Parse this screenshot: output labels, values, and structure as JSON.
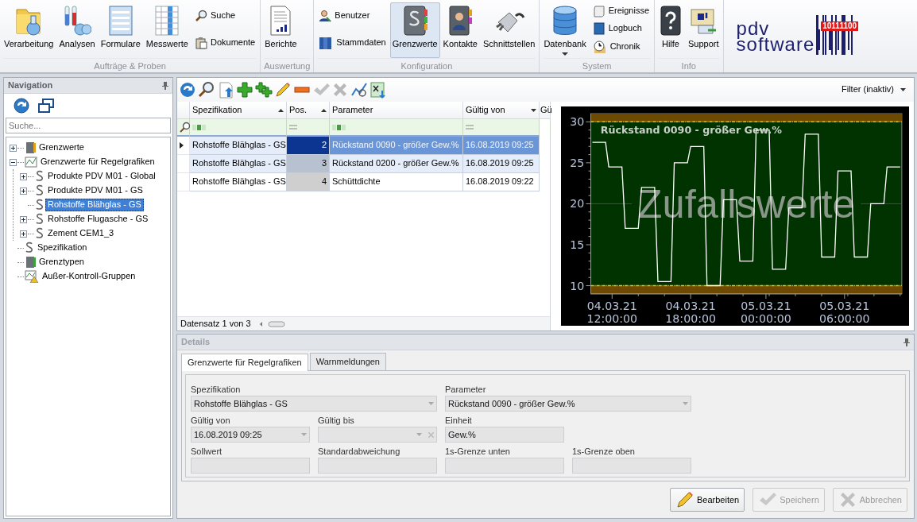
{
  "ribbon": {
    "groups": [
      {
        "label": "Aufträge & Proben",
        "items": [
          {
            "label": "Verarbeitung",
            "kind": "large",
            "selected": false
          },
          {
            "label": "Analysen",
            "kind": "large",
            "selected": false
          },
          {
            "label": "Formulare",
            "kind": "large",
            "selected": false
          },
          {
            "label": "Messwerte",
            "kind": "large",
            "selected": false
          },
          {
            "label": "Suche",
            "kind": "small",
            "selected": false
          },
          {
            "label": "Dokumente",
            "kind": "small",
            "selected": false
          }
        ]
      },
      {
        "label": "Auswertung",
        "items": [
          {
            "label": "Berichte",
            "kind": "large",
            "selected": false
          }
        ]
      },
      {
        "label": "Konfiguration",
        "items": [
          {
            "label": "Benutzer",
            "kind": "small",
            "selected": false
          },
          {
            "label": "Stammdaten",
            "kind": "small",
            "selected": false
          },
          {
            "label": "Grenzwerte",
            "kind": "large",
            "selected": true
          },
          {
            "label": "Kontakte",
            "kind": "large",
            "selected": false
          },
          {
            "label": "Schnittstellen",
            "kind": "large",
            "selected": false
          }
        ]
      },
      {
        "label": "System",
        "items": [
          {
            "label": "Datenbank",
            "kind": "large",
            "selected": false,
            "dropdown": true
          },
          {
            "label": "Ereignisse",
            "kind": "small",
            "selected": false
          },
          {
            "label": "Logbuch",
            "kind": "small",
            "selected": false
          },
          {
            "label": "Chronik",
            "kind": "small",
            "selected": false
          }
        ]
      },
      {
        "label": "Info",
        "items": [
          {
            "label": "Hilfe",
            "kind": "large",
            "selected": false
          },
          {
            "label": "Support",
            "kind": "large",
            "selected": false
          }
        ]
      }
    ],
    "logo": {
      "line_1": "pdv",
      "line_2": "software",
      "code": "10111100"
    }
  },
  "navigation": {
    "title": "Navigation",
    "search": {
      "placeholder": "Suche..."
    },
    "tree": [
      {
        "label": "Grenzwerte",
        "expanded": false,
        "selected": false
      },
      {
        "label": "Grenzwerte für Regelgrafiken",
        "expanded": true,
        "selected": false,
        "children": [
          {
            "label": "Produkte PDV M01 - Global",
            "expanded": false,
            "selected": false
          },
          {
            "label": "Produkte PDV M01 - GS",
            "expanded": false,
            "selected": false
          },
          {
            "label": "Rohstoffe Blähglas - GS",
            "selected": true
          },
          {
            "label": "Rohstoffe Flugasche - GS",
            "expanded": false,
            "selected": false
          },
          {
            "label": "Zement CEM1_3",
            "expanded": false,
            "selected": false
          }
        ]
      },
      {
        "label": "Spezifikation",
        "selected": false
      },
      {
        "label": "Grenztypen",
        "selected": false
      },
      {
        "label": "Außer-Kontroll-Gruppen",
        "selected": false
      }
    ]
  },
  "toolbar": {
    "filter": "Filter (inaktiv)"
  },
  "table": {
    "columns": [
      {
        "label": "Spezifikation",
        "sorted": true,
        "descending": false
      },
      {
        "label": "Pos.",
        "sorted": true,
        "descending": false
      },
      {
        "label": "Parameter",
        "sorted": false
      },
      {
        "label": "Gültig von",
        "sorted": true,
        "descending": true
      },
      {
        "label": "Gü",
        "sorted": false
      }
    ],
    "rows": [
      {
        "cells": [
          "Rohstoffe Blähglas - GS",
          "2",
          "Rückstand 0090 - größer Gew.%",
          "16.08.2019 09:25"
        ],
        "selected": true,
        "current": true
      },
      {
        "cells": [
          "Rohstoffe Blähglas - GS",
          "3",
          "Rückstand 0200 - größer Gew.%",
          "16.08.2019 09:25"
        ],
        "selected": true,
        "current": false
      },
      {
        "cells": [
          "Rohstoffe Blähglas - GS",
          "4",
          "Schüttdichte",
          "16.08.2019 09:22"
        ],
        "selected": false,
        "current": false
      }
    ],
    "footer": "Datensatz 1 von 3"
  },
  "chart": {
    "chart_data": {
      "type": "line",
      "title": "Rückstand 0090 - größer Gew.%",
      "categories": [
        null,
        null,
        null,
        null,
        null,
        null,
        "04.03.21 12:00:00",
        null,
        null,
        null,
        null,
        null,
        null,
        null,
        null,
        null,
        null,
        null,
        null,
        null,
        null,
        null,
        null,
        null,
        null,
        null,
        null,
        null,
        null,
        null,
        "04.03.21 18:00:00",
        null,
        null,
        null,
        null,
        null,
        null,
        null,
        null,
        null,
        null,
        null,
        null,
        null,
        null,
        null,
        null,
        null,
        null,
        null,
        null,
        null,
        null,
        "05.03.21 00:00:00",
        null,
        null,
        null,
        null,
        null,
        null,
        null,
        null,
        null,
        null,
        null,
        null,
        null,
        null,
        null,
        null,
        null,
        null,
        null,
        null,
        null,
        null,
        null,
        "05.03.21 06:00:00",
        null,
        null,
        null,
        null,
        null,
        null,
        null,
        null,
        null,
        null,
        null,
        null,
        null,
        null,
        null,
        null,
        null
      ],
      "series": [
        {
          "color": "#ffffff",
          "values": [
            27.5,
            27.5,
            27.5,
            27.5,
            27.5,
            24.5,
            24.5,
            24.5,
            24.5,
            24.5,
            17,
            17,
            17,
            17,
            17,
            22,
            22,
            22,
            22,
            22,
            10.5,
            10.5,
            10.5,
            10.5,
            10.5,
            25,
            25,
            25,
            25,
            25,
            27,
            27,
            27,
            27,
            27,
            10,
            10,
            10,
            10,
            10,
            20.5,
            20.5,
            20.5,
            20.5,
            20.5,
            13,
            13,
            13,
            13,
            13,
            29,
            29,
            29,
            29,
            29,
            12,
            12,
            12,
            12,
            12,
            19.5,
            19.5,
            19.5,
            19.5,
            19.5,
            28.5,
            28.5,
            28.5,
            28.5,
            28.5,
            13.5,
            13.5,
            13.5,
            13.5,
            13.5,
            24,
            24,
            24,
            24,
            24,
            13.5,
            13.5,
            13.5,
            13.5,
            13.5,
            20,
            20,
            20,
            20,
            20,
            24.5,
            24.5,
            24.5,
            24.5,
            24.5
          ]
        }
      ],
      "ylim": [
        9,
        31
      ],
      "yticks": [
        10,
        15,
        20,
        25,
        30
      ],
      "bands": [
        {
          "axis": "y",
          "from": 30,
          "to": 31
        },
        {
          "axis": "y",
          "from": 9,
          "to": 10
        }
      ],
      "ref_lines": [
        {
          "axis": "y",
          "value": 30
        },
        {
          "axis": "y",
          "value": 10
        }
      ],
      "annotations": [
        "Zufallswerte"
      ]
    }
  },
  "details": {
    "title": "Details",
    "tabs": [
      {
        "label": "Grenzwerte für Regelgrafiken",
        "selected": true
      },
      {
        "label": "Warnmeldungen",
        "selected": false
      }
    ],
    "rows": [
      [
        {
          "label": "Spezifikation",
          "value": "Rohstoffe Blähglas - GS",
          "kind": "combo_wide"
        },
        "",
        {
          "label": "Parameter",
          "value": "Rückstand 0090 - größer Gew.%",
          "kind": "combo_wide"
        }
      ],
      [
        {
          "label": "Gültig von",
          "value": "16.08.2019 09:25",
          "kind": "date"
        },
        {
          "label": "Gültig bis",
          "kind": "date_clear"
        },
        {
          "label": "Einheit",
          "value": "Gew.%",
          "kind": "text"
        }
      ],
      [
        {
          "label": "Sollwert",
          "kind": "text"
        },
        {
          "label": "Standardabweichung",
          "kind": "text"
        },
        {
          "label": "1s-Grenze unten",
          "kind": "text"
        },
        {
          "label": "1s-Grenze oben",
          "kind": "text"
        }
      ]
    ],
    "buttons": [
      {
        "label": "Bearbeiten",
        "disabled": false
      },
      {
        "label": "Speichern",
        "disabled": true
      },
      {
        "label": "Abbrechen",
        "disabled": true
      }
    ]
  }
}
